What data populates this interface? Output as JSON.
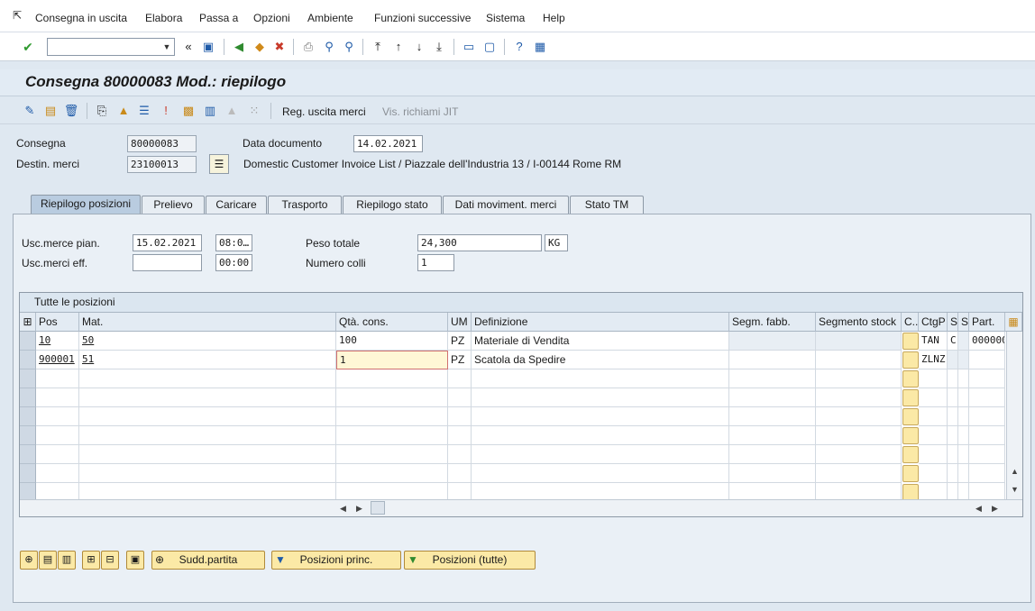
{
  "menu": {
    "items": [
      {
        "id": "consegna",
        "label": "Consegna in uscita"
      },
      {
        "id": "elabora",
        "label": "Elabora"
      },
      {
        "id": "passa",
        "label": "Passa a"
      },
      {
        "id": "opzioni",
        "label": "Opzioni"
      },
      {
        "id": "ambiente",
        "label": "Ambiente"
      },
      {
        "id": "funzioni",
        "label": "Funzioni successive"
      },
      {
        "id": "sistema",
        "label": "Sistema"
      },
      {
        "id": "help",
        "label": "Help"
      }
    ]
  },
  "command_field": {
    "value": ""
  },
  "title": "Consegna 80000083 Mod.: riepilogo",
  "app_toolbar": {
    "reg_uscita": "Reg. uscita merci",
    "vis_richiami": "Vis. richiami JIT"
  },
  "header": {
    "consegna_label": "Consegna",
    "consegna_value": "80000083",
    "destin_label": "Destin. merci",
    "destin_value": "23100013",
    "data_doc_label": "Data documento",
    "data_doc_value": "14.02.2021",
    "address": "Domestic Customer Invoice List / Piazzale dell'Industria 13 / I-00144 Rome RM"
  },
  "tabs": [
    {
      "label": "Riepilogo posizioni",
      "active": true
    },
    {
      "label": "Prelievo"
    },
    {
      "label": "Caricare"
    },
    {
      "label": "Trasporto"
    },
    {
      "label": "Riepilogo stato"
    },
    {
      "label": "Dati moviment. merci"
    },
    {
      "label": "Stato TM"
    }
  ],
  "panel": {
    "usc_pian_label": "Usc.merce pian.",
    "usc_pian_date": "15.02.2021",
    "usc_pian_time": "08:0…",
    "usc_eff_label": "Usc.merci eff.",
    "usc_eff_date": "",
    "usc_eff_time": "00:00",
    "peso_label": "Peso totale",
    "peso_value": "24,300",
    "peso_unit": "KG",
    "colli_label": "Numero colli",
    "colli_value": "1"
  },
  "table": {
    "title": "Tutte le posizioni",
    "headers": {
      "pos": "Pos",
      "mat": "Mat.",
      "qta": "Qtà. cons.",
      "um": "UM",
      "def": "Definizione",
      "segm_fabb": "Segm. fabb.",
      "segm_stock": "Segmento stock",
      "c": "C..",
      "ctgp": "CtgP",
      "s1": "S",
      "s2": "S",
      "part": "Part."
    },
    "rows": [
      {
        "pos": "10",
        "mat": "50",
        "qta": "100",
        "um": "PZ",
        "def": "Materiale di Vendita",
        "ctgp": "TAN",
        "s1": "C",
        "part": "000000"
      },
      {
        "pos": "900001",
        "mat": "51",
        "qta": "1",
        "um": "PZ",
        "def": "Scatola da Spedire",
        "ctgp": "ZLNZ",
        "s1": "",
        "part": ""
      }
    ]
  },
  "bottom": {
    "sudd_partita": "Sudd.partita",
    "posizioni_princ": "Posizioni princ.",
    "posizioni_tutte": "Posizioni (tutte)"
  }
}
